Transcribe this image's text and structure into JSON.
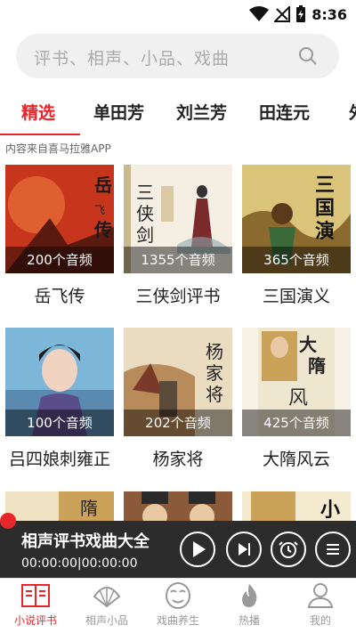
{
  "status": {
    "time": "8:36"
  },
  "search": {
    "placeholder": "评书、相声、小品、戏曲"
  },
  "tabs": [
    "精选",
    "单田芳",
    "刘兰芳",
    "田连元",
    "外"
  ],
  "source_note": "内容来自喜马拉雅APP",
  "albums": [
    {
      "title": "岳飞传",
      "count": "200个音频",
      "cover_text": "岳飞传"
    },
    {
      "title": "三侠剑评书",
      "count": "1355个音频",
      "cover_text": "三侠剑"
    },
    {
      "title": "三国演义",
      "count": "365个音频",
      "cover_text": "三国演"
    },
    {
      "title": "吕四娘刺雍正",
      "count": "100个音频",
      "cover_text": ""
    },
    {
      "title": "杨家将",
      "count": "202个音频",
      "cover_text": "杨家将"
    },
    {
      "title": "大隋风云",
      "count": "425个音频",
      "cover_text": "大隋风"
    }
  ],
  "player": {
    "title": "相声评书戏曲大全",
    "time": "00:00:00|00:00:00"
  },
  "nav": [
    {
      "label": "小说评书",
      "icon": "book-icon"
    },
    {
      "label": "相声小品",
      "icon": "fan-icon"
    },
    {
      "label": "戏曲养生",
      "icon": "opera-mask-icon"
    },
    {
      "label": "热播",
      "icon": "flame-icon"
    },
    {
      "label": "我的",
      "icon": "person-icon"
    }
  ],
  "colors": {
    "accent": "#e8262a",
    "player_bg": "#2c2c2c"
  }
}
